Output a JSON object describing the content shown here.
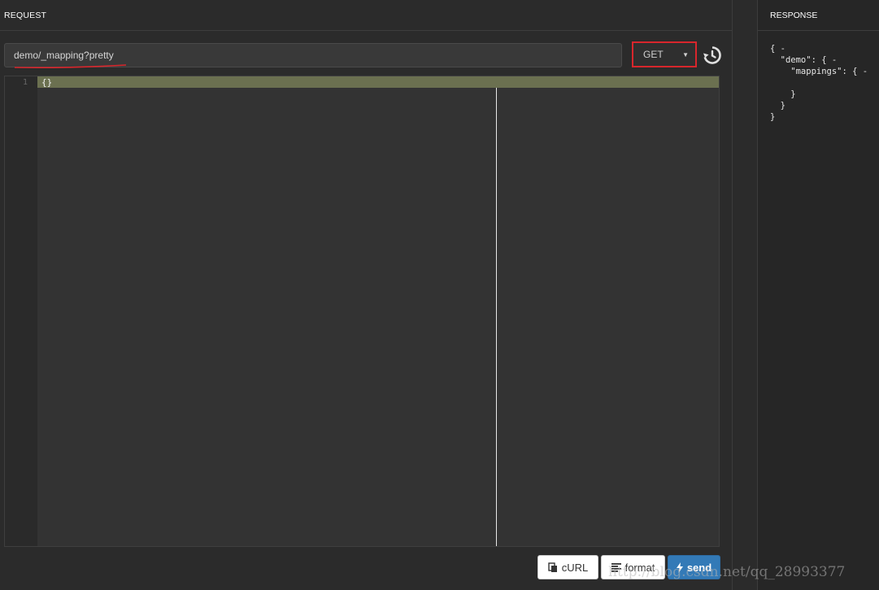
{
  "request": {
    "header": "REQUEST",
    "url_value": "demo/_mapping?pretty",
    "method": "GET",
    "editor": {
      "line_number": "1",
      "code": "{}"
    },
    "buttons": {
      "curl": "cURL",
      "format": "format",
      "send": "send"
    }
  },
  "response": {
    "header": "RESPONSE",
    "body": "{ -\n  \"demo\": { -\n    \"mappings\": { -\n\n    }\n  }\n}"
  },
  "watermark": "http://blog.csdn.net/qq_28993377",
  "colors": {
    "method_highlight": "#d8262c",
    "send_button": "#337ab7",
    "active_line": "#6b7050"
  }
}
